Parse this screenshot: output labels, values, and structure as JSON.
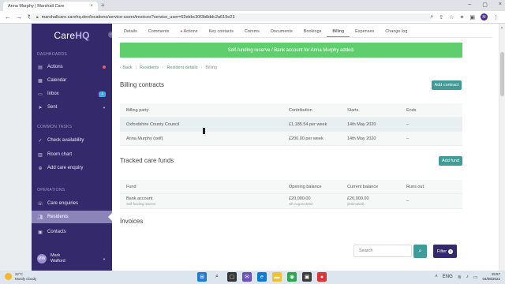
{
  "browser": {
    "tab_title": "Anna Murphy | Marshall Care",
    "url": "marshallcare.carehq.dev/locations/service-users/invoices?service_user=62ebbc30f3b8ddc2a619e23",
    "profile_initial": "M"
  },
  "sidebar": {
    "logo_a": "Care",
    "logo_b": "HQ",
    "sections": [
      {
        "title": "DASHBOARDS",
        "items": [
          {
            "label": "Actions",
            "icon": "clipboard-icon"
          },
          {
            "label": "Calendar",
            "icon": "calendar-icon"
          },
          {
            "label": "Inbox",
            "icon": "inbox-icon",
            "badge": "1"
          },
          {
            "label": "Sent",
            "icon": "send-icon"
          }
        ]
      },
      {
        "title": "COMMON TASKS",
        "items": [
          {
            "label": "Check availability",
            "icon": "check-icon"
          },
          {
            "label": "Room chart",
            "icon": "chart-icon"
          },
          {
            "label": "Add care enquiry",
            "icon": "add-icon"
          }
        ]
      },
      {
        "title": "OPERATIONS",
        "items": [
          {
            "label": "Care enquiries",
            "icon": "phone-icon"
          },
          {
            "label": "Residents",
            "icon": "users-icon"
          },
          {
            "label": "Contacts",
            "icon": "contacts-icon"
          }
        ]
      }
    ],
    "user": {
      "initials": "MW",
      "first": "Mark",
      "last": "Walford"
    }
  },
  "tabs": [
    "Details",
    "Comments",
    "Actions",
    "Key contacts",
    "Comms",
    "Documents",
    "Bookings",
    "Billing",
    "Expenses",
    "Change log"
  ],
  "active_tab": "Billing",
  "alert": "Self-funding reserve / Bank account for Anna Murphy added.",
  "breadcrumb": {
    "back": "‹ Back",
    "items": [
      "Residents",
      "Resident details"
    ],
    "current": "Billing"
  },
  "billing_contracts": {
    "title": "Billing contracts",
    "add_label": "Add contract",
    "columns": [
      "Billing party",
      "Contribution",
      "Starts",
      "Ends"
    ],
    "rows": [
      {
        "party": "Oxfordshire County Council",
        "contribution": "£1,185.54 per week",
        "starts": "14th May 2020",
        "ends": "–"
      },
      {
        "party": "Anna Murphy (self)",
        "contribution": "£200.00 per week",
        "starts": "14th May 2020",
        "ends": "–"
      }
    ]
  },
  "care_funds": {
    "title": "Tracked care funds",
    "add_label": "Add fund",
    "columns": [
      "Fund",
      "Opening balance",
      "Current balance",
      "Runs out"
    ],
    "rows": [
      {
        "fund": "Bank account",
        "fund_sub": "Self-funding reserve",
        "opening": "£20,000.00",
        "opening_sub": "4th August 2022",
        "current": "£20,000.00",
        "current_sub": "(Estimated)",
        "runs_out": "–"
      }
    ]
  },
  "invoices": {
    "title": "Invoices",
    "search_placeholder": "Search",
    "filter_label": "Filter",
    "filter_count": "0"
  },
  "taskbar": {
    "temp": "22°C",
    "weather": "Mostly cloudy",
    "lang": "ENG",
    "time": "15:57",
    "date": "04/08/2022"
  }
}
